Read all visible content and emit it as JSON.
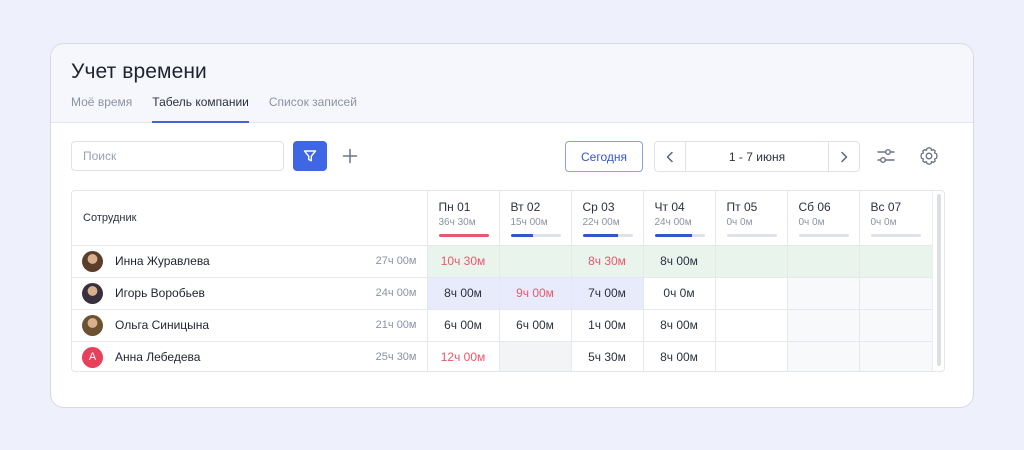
{
  "title": "Учет времени",
  "tabs": [
    {
      "label": "Моё время",
      "active": false
    },
    {
      "label": "Табель компании",
      "active": true
    },
    {
      "label": "Список записей",
      "active": false
    }
  ],
  "toolbar": {
    "search_placeholder": "Поиск",
    "filter_icon": "filter-icon",
    "add_icon": "plus-icon",
    "today_label": "Сегодня",
    "date_range": "1 - 7 июня",
    "prev_icon": "chevron-left-icon",
    "next_icon": "chevron-right-icon",
    "settings_sliders_icon": "sliders-icon",
    "settings_gear_icon": "gear-icon"
  },
  "colors": {
    "accent": "#3f66e5",
    "overtime_red": "#e8596b",
    "bar_blue": "#3556c7"
  },
  "table": {
    "employee_header": "Сотрудник",
    "days": [
      {
        "name": "Пн 01",
        "total": "36ч 30м",
        "progress": 1.0,
        "bar_color": "#e8596b"
      },
      {
        "name": "Вт 02",
        "total": "15ч 00м",
        "progress": 0.45,
        "bar_color": "#3556c7"
      },
      {
        "name": "Ср 03",
        "total": "22ч 00м",
        "progress": 0.7,
        "bar_color": "#3556c7"
      },
      {
        "name": "Чт 04",
        "total": "24ч 00м",
        "progress": 0.75,
        "bar_color": "#3556c7"
      },
      {
        "name": "Пт 05",
        "total": "0ч 0м",
        "progress": 0,
        "bar_color": "#3556c7"
      },
      {
        "name": "Сб 06",
        "total": "0ч 0м",
        "progress": 0,
        "bar_color": "#3556c7"
      },
      {
        "name": "Вс 07",
        "total": "0ч 0м",
        "progress": 0,
        "bar_color": "#3556c7"
      }
    ],
    "rows": [
      {
        "name": "Инна Журавлева",
        "total": "27ч 00м",
        "avatar": "photo",
        "avatar_color": "#5a3e2b",
        "cells": [
          {
            "value": "10ч 30м",
            "red": true,
            "bg": "green"
          },
          {
            "value": "",
            "red": false,
            "bg": "green"
          },
          {
            "value": "8ч 30м",
            "red": true,
            "bg": "green"
          },
          {
            "value": "8ч 00м",
            "red": false,
            "bg": "green"
          },
          {
            "value": "",
            "red": false,
            "bg": "green"
          },
          {
            "value": "",
            "red": false,
            "bg": "green"
          },
          {
            "value": "",
            "red": false,
            "bg": "green"
          }
        ]
      },
      {
        "name": "Игорь Воробьев",
        "total": "24ч 00м",
        "avatar": "photo",
        "avatar_color": "#3a2f3c",
        "cells": [
          {
            "value": "8ч 00м",
            "red": false,
            "bg": "blue"
          },
          {
            "value": "9ч 00м",
            "red": true,
            "bg": "blue"
          },
          {
            "value": "7ч 00м",
            "red": false,
            "bg": "blue"
          },
          {
            "value": "0ч 0м",
            "red": false,
            "bg": ""
          },
          {
            "value": "",
            "red": false,
            "bg": ""
          },
          {
            "value": "",
            "red": false,
            "bg": "light"
          },
          {
            "value": "",
            "red": false,
            "bg": "light"
          }
        ]
      },
      {
        "name": "Ольга Синицына",
        "total": "21ч 00м",
        "avatar": "photo",
        "avatar_color": "#6b5233",
        "cells": [
          {
            "value": "6ч 00м",
            "red": false,
            "bg": ""
          },
          {
            "value": "6ч 00м",
            "red": false,
            "bg": ""
          },
          {
            "value": "1ч 00м",
            "red": false,
            "bg": ""
          },
          {
            "value": "8ч 00м",
            "red": false,
            "bg": ""
          },
          {
            "value": "",
            "red": false,
            "bg": ""
          },
          {
            "value": "",
            "red": false,
            "bg": "light"
          },
          {
            "value": "",
            "red": false,
            "bg": "light"
          }
        ]
      },
      {
        "name": "Анна Лебедева",
        "total": "25ч 30м",
        "avatar": "initial",
        "initial": "A",
        "avatar_color": "#e8405a",
        "cells": [
          {
            "value": "12ч 00м",
            "red": true,
            "bg": ""
          },
          {
            "value": "",
            "red": false,
            "bg": "gray"
          },
          {
            "value": "5ч 30м",
            "red": false,
            "bg": ""
          },
          {
            "value": "8ч 00м",
            "red": false,
            "bg": ""
          },
          {
            "value": "",
            "red": false,
            "bg": ""
          },
          {
            "value": "",
            "red": false,
            "bg": "light"
          },
          {
            "value": "",
            "red": false,
            "bg": "light"
          }
        ]
      }
    ]
  }
}
